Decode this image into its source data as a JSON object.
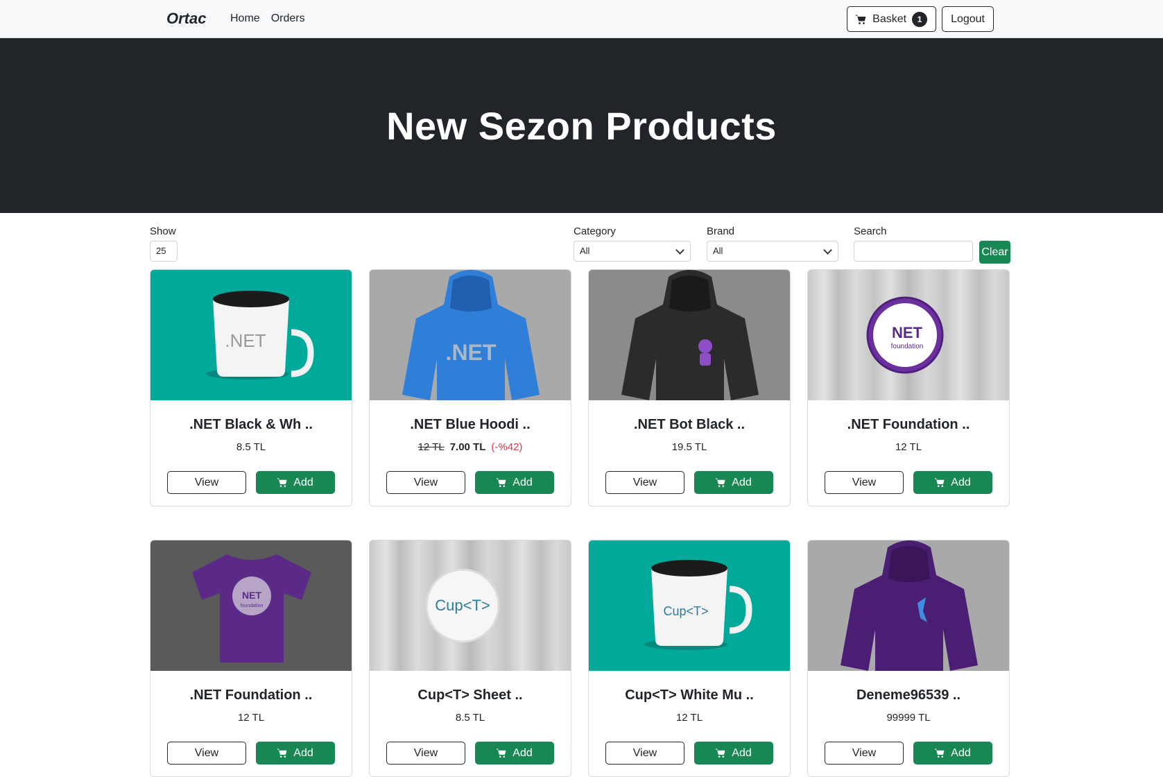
{
  "navbar": {
    "brand": "Ortac",
    "links": [
      "Home",
      "Orders"
    ],
    "basket_label": "Basket",
    "basket_count": "1",
    "logout_label": "Logout"
  },
  "hero": {
    "title": "New Sezon Products"
  },
  "filters": {
    "show_label": "Show",
    "show_value": "25",
    "category_label": "Category",
    "category_value": "All",
    "brand_label": "Brand",
    "brand_value": "All",
    "search_label": "Search",
    "search_value": "",
    "clear_label": "Clear"
  },
  "products": [
    {
      "title": ".NET Black & Wh ..",
      "price": "8.5 TL",
      "image": "mug-net",
      "view_label": "View",
      "add_label": "Add"
    },
    {
      "title": ".NET Blue Hoodi ..",
      "old_price": "12 TL",
      "new_price": "7.00 TL",
      "discount": "(-%42)",
      "image": "hoodie-blue",
      "view_label": "View",
      "add_label": "Add"
    },
    {
      "title": ".NET Bot Black ..",
      "price": "19.5 TL",
      "image": "hoodie-black",
      "view_label": "View",
      "add_label": "Add"
    },
    {
      "title": ".NET Foundation ..",
      "price": "12 TL",
      "image": "pin-net",
      "view_label": "View",
      "add_label": "Add"
    },
    {
      "title": ".NET Foundation ..",
      "price": "12 TL",
      "image": "tshirt-purple",
      "view_label": "View",
      "add_label": "Add"
    },
    {
      "title": "Cup<T> Sheet ..",
      "price": "8.5 TL",
      "image": "pin-cup",
      "view_label": "View",
      "add_label": "Add"
    },
    {
      "title": "Cup<T> White Mu ..",
      "price": "12 TL",
      "image": "mug-cup",
      "view_label": "View",
      "add_label": "Add"
    },
    {
      "title": "Deneme96539 ..",
      "price": "99999 TL",
      "image": "hoodie-purple",
      "view_label": "View",
      "add_label": "Add"
    }
  ],
  "image_text": {
    "net": ".NET",
    "net_foundation_1": "NET",
    "net_foundation_2": "foundation",
    "cup": "Cup<T>"
  },
  "colors": {
    "success": "#198754",
    "dark": "#212529",
    "danger": "#dc3545",
    "teal": "#00a99a",
    "purple": "#5b2a86",
    "blue": "#2f7fd8"
  }
}
